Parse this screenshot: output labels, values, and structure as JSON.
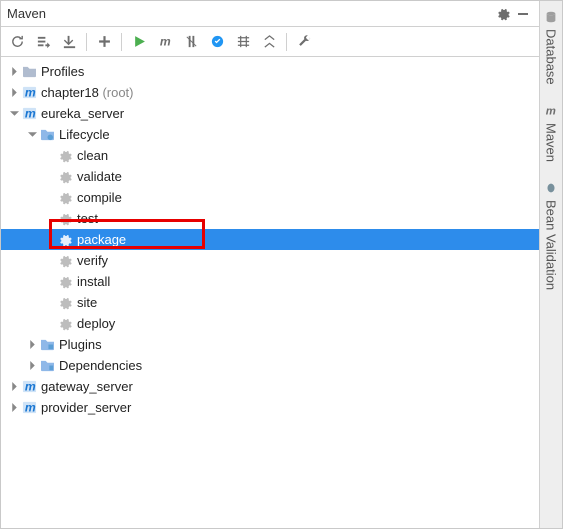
{
  "title": "Maven",
  "sideTabs": {
    "database": "Database",
    "maven": "Maven",
    "beanValidation": "Bean Validation"
  },
  "tree": {
    "profiles": "Profiles",
    "chapter18": "chapter18",
    "chapter18_suffix": " (root)",
    "eureka_server": "eureka_server",
    "lifecycle": "Lifecycle",
    "goals": {
      "clean": "clean",
      "validate": "validate",
      "compile": "compile",
      "test": "test",
      "package": "package",
      "verify": "verify",
      "install": "install",
      "site": "site",
      "deploy": "deploy"
    },
    "plugins": "Plugins",
    "dependencies": "Dependencies",
    "gateway_server": "gateway_server",
    "provider_server": "provider_server"
  }
}
